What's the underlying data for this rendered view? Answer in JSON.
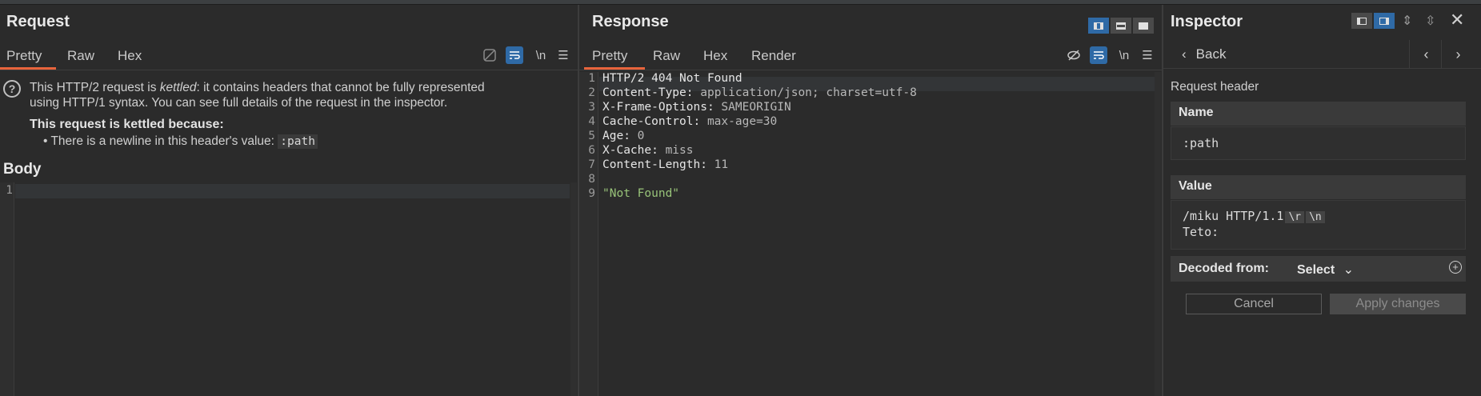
{
  "request": {
    "title": "Request",
    "tabs": [
      "Pretty",
      "Raw",
      "Hex"
    ],
    "active_tab": "Pretty",
    "tool_newline": "\\n",
    "notice": {
      "line1_pre": "This HTTP/2 request is ",
      "line1_em": "kettled",
      "line1_post": ": it contains headers that cannot be fully represented",
      "line2": "using HTTP/1 syntax. You can see full details of the request in the inspector.",
      "heading": "This request is kettled because:",
      "bullet_text": "There is a newline in this header's value: ",
      "bullet_code": ":path"
    },
    "body_title": "Body",
    "body_line_numbers": [
      "1"
    ]
  },
  "response": {
    "title": "Response",
    "tabs": [
      "Pretty",
      "Raw",
      "Hex",
      "Render"
    ],
    "active_tab": "Pretty",
    "tool_newline": "\\n",
    "lines": [
      {
        "n": "1",
        "name": "HTTP/2 404 Not Found",
        "value": ""
      },
      {
        "n": "2",
        "name": "Content-Type:",
        "value": " application/json; charset=utf-8"
      },
      {
        "n": "3",
        "name": "X-Frame-Options:",
        "value": " SAMEORIGIN"
      },
      {
        "n": "4",
        "name": "Cache-Control:",
        "value": " max-age=30"
      },
      {
        "n": "5",
        "name": "Age:",
        "value": " 0"
      },
      {
        "n": "6",
        "name": "X-Cache:",
        "value": " miss"
      },
      {
        "n": "7",
        "name": "Content-Length:",
        "value": " 11"
      },
      {
        "n": "8",
        "name": "",
        "value": ""
      },
      {
        "n": "9",
        "name": "",
        "value": "\"Not Found\""
      }
    ]
  },
  "inspector": {
    "title": "Inspector",
    "back_label": "Back",
    "section_label": "Request header",
    "name_label": "Name",
    "name_value": ":path",
    "value_label": "Value",
    "value_line1": "/miku HTTP/1.1",
    "value_esc1": "\\r",
    "value_esc2": "\\n",
    "value_line2": "Teto:",
    "decoded_label": "Decoded from:",
    "decoded_select": "Select",
    "cancel_label": "Cancel",
    "apply_label": "Apply changes"
  },
  "colors": {
    "accent_tab": "#e8643c",
    "active_tool": "#2f6aa6",
    "string": "#98c379"
  }
}
